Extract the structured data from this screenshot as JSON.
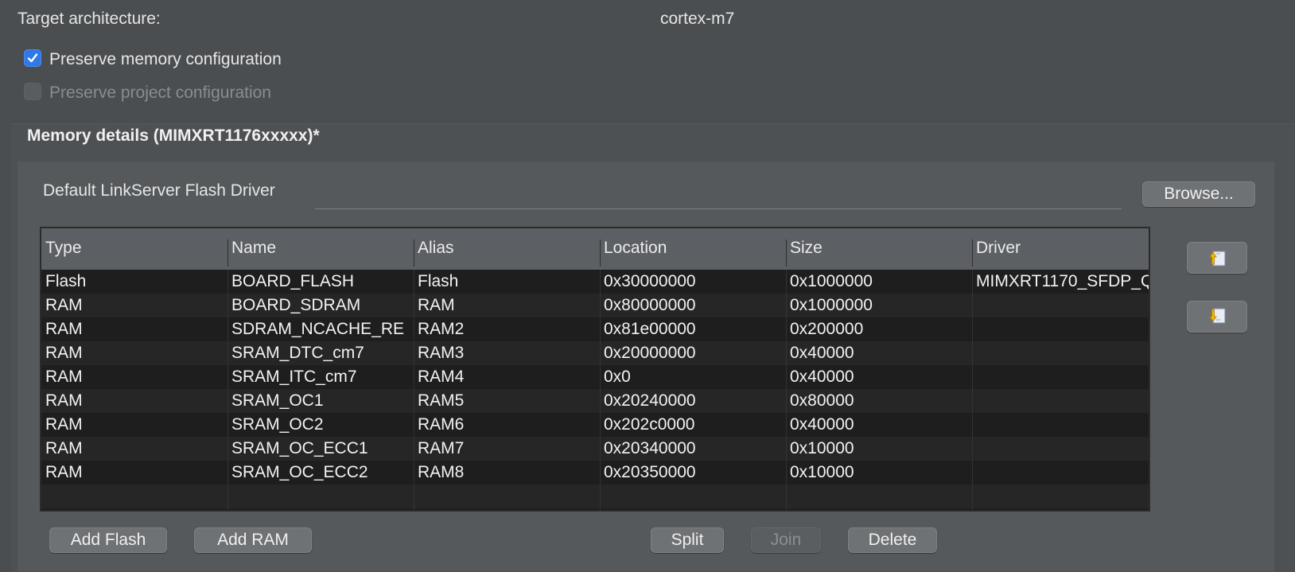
{
  "target": {
    "label": "Target architecture:",
    "value": "cortex-m7"
  },
  "options": {
    "preserve_memory": {
      "label": "Preserve memory configuration",
      "checked": true
    },
    "preserve_project": {
      "label": "Preserve project configuration",
      "checked": false,
      "disabled": true
    }
  },
  "memory": {
    "title": "Memory details (MIMXRT1176xxxxx)*",
    "flash_driver_label": "Default LinkServer Flash Driver",
    "flash_driver_value": "",
    "browse_label": "Browse...",
    "columns": [
      "Type",
      "Name",
      "Alias",
      "Location",
      "Size",
      "Driver"
    ],
    "rows": [
      [
        "Flash",
        "BOARD_FLASH",
        "Flash",
        "0x30000000",
        "0x1000000",
        "MIMXRT1170_SFDP_Q"
      ],
      [
        "RAM",
        "BOARD_SDRAM",
        "RAM",
        "0x80000000",
        "0x1000000",
        ""
      ],
      [
        "RAM",
        "SDRAM_NCACHE_RE",
        "RAM2",
        "0x81e00000",
        "0x200000",
        ""
      ],
      [
        "RAM",
        "SRAM_DTC_cm7",
        "RAM3",
        "0x20000000",
        "0x40000",
        ""
      ],
      [
        "RAM",
        "SRAM_ITC_cm7",
        "RAM4",
        "0x0",
        "0x40000",
        ""
      ],
      [
        "RAM",
        "SRAM_OC1",
        "RAM5",
        "0x20240000",
        "0x80000",
        ""
      ],
      [
        "RAM",
        "SRAM_OC2",
        "RAM6",
        "0x202c0000",
        "0x40000",
        ""
      ],
      [
        "RAM",
        "SRAM_OC_ECC1",
        "RAM7",
        "0x20340000",
        "0x10000",
        ""
      ],
      [
        "RAM",
        "SRAM_OC_ECC2",
        "RAM8",
        "0x20350000",
        "0x10000",
        ""
      ]
    ],
    "move_up_icon": "move-up-icon",
    "move_down_icon": "move-down-icon"
  },
  "actions": {
    "add_flash": "Add Flash",
    "add_ram": "Add RAM",
    "split": "Split",
    "join": "Join",
    "delete": "Delete"
  },
  "colors": {
    "accent": "#2f79e6",
    "window_bg": "#4b4e50",
    "table_bg": "#1e1e1e"
  }
}
